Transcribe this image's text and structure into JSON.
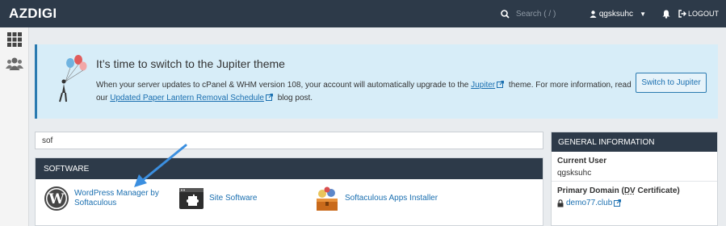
{
  "header": {
    "brand": "AZDIGI",
    "search_placeholder": "Search ( / )",
    "username": "qgsksuhc",
    "logout_label": "LOGOUT"
  },
  "notice": {
    "title": "It’s time to switch to the Jupiter theme",
    "body_start": "When your server updates to cPanel & WHM version 108, your account will automatically upgrade to the",
    "jupiter_link": "Jupiter",
    "body_mid": "theme. For more information, read our",
    "removal_link": "Updated Paper Lantern Removal Schedule",
    "body_end": "blog post.",
    "switch_button": "Switch to Jupiter"
  },
  "filter": {
    "value": "sof"
  },
  "software": {
    "heading": "SOFTWARE",
    "apps": [
      {
        "label": "WordPress Manager by Softaculous",
        "icon": "wordpress-icon"
      },
      {
        "label": "Site Software",
        "icon": "site-software-icon"
      },
      {
        "label": "Softaculous Apps Installer",
        "icon": "softaculous-icon"
      }
    ]
  },
  "general_info": {
    "heading": "GENERAL INFORMATION",
    "current_user_label": "Current User",
    "current_user": "qgsksuhc",
    "primary_domain_label_start": "Primary Domain (",
    "primary_domain_dv": "DV",
    "primary_domain_label_end": " Certificate)",
    "domain": "demo77.club"
  },
  "colors": {
    "topbar": "#2d3a49",
    "notice_bg": "#d7edf8",
    "link": "#1a6fb0",
    "arrow": "#3b8fe0"
  }
}
